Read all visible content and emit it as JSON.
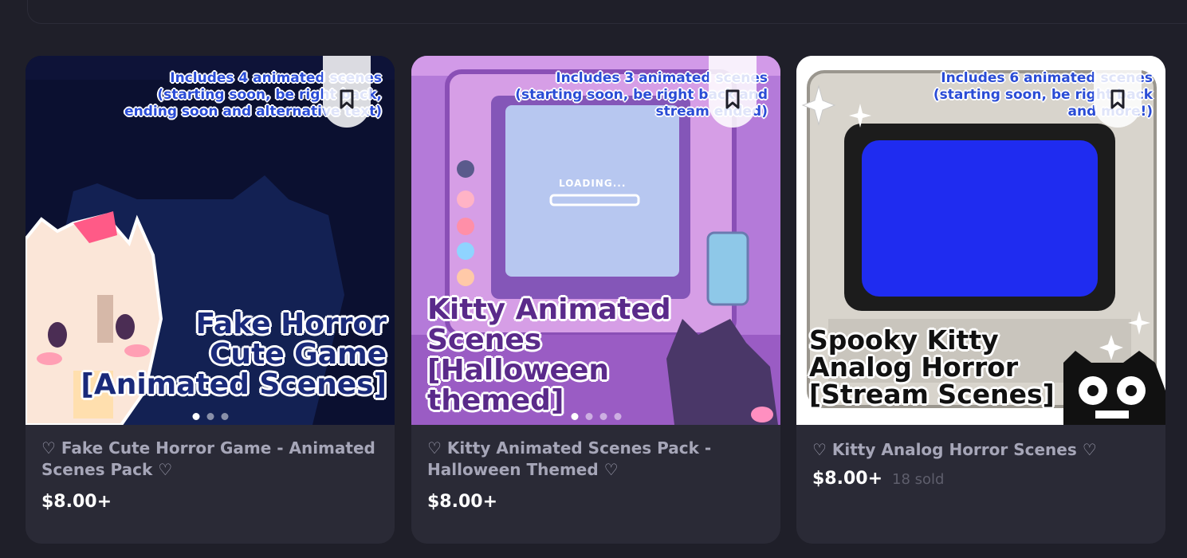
{
  "cards": [
    {
      "overlay": "Includes 4 animated scenes\n(starting soon, be right back,\nending soon and alternative text)",
      "big_title": "Fake Horror\nCute Game\n[Animated Scenes]",
      "title": "♡ Fake Cute Horror Game - Animated Scenes Pack ♡",
      "price": "$8.00+",
      "sold": ""
    },
    {
      "overlay": "Includes 3 animated scenes\n(starting soon, be right back and\nstream ended)",
      "big_title": "Kitty Animated\nScenes\n[Halloween\nthemed]",
      "title": "♡ Kitty Animated Scenes Pack - Halloween Themed ♡",
      "price": "$8.00+",
      "sold": ""
    },
    {
      "overlay": "Includes 6 animated scenes\n(starting soon, be right back\nand more!)",
      "big_title": "Spooky Kitty\nAnalog Horror\n[Stream Scenes]",
      "title": "♡ Kitty Analog Horror Scenes ♡",
      "price": "$8.00+",
      "sold": "18 sold"
    }
  ],
  "screen_text": "LOADING...",
  "colors": {
    "page_bg": "#1f1f29",
    "card_bg": "#2a2a36",
    "overlay_blue": "#2a4cd6",
    "price": "#ffffff",
    "title": "#a6a6b8"
  },
  "icons": [
    "bookmark-icon",
    "heart-icon"
  ]
}
